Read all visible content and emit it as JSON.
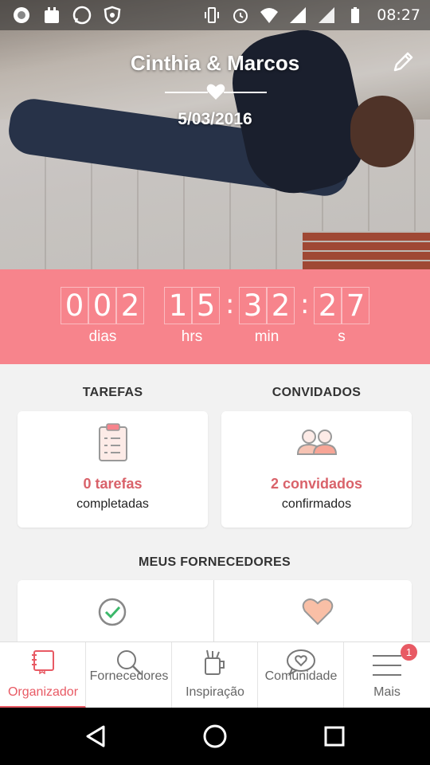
{
  "status_bar": {
    "time": "08:27"
  },
  "hero": {
    "couple_names": "Cinthia & Marcos",
    "date": "5/03/2016"
  },
  "countdown": {
    "days_digits": [
      "0",
      "0",
      "2"
    ],
    "hours_digits": [
      "1",
      "5"
    ],
    "minutes_digits": [
      "3",
      "2"
    ],
    "seconds_digits": [
      "2",
      "7"
    ],
    "separator": ":",
    "labels": {
      "days": "dias",
      "hours": "hrs",
      "minutes": "min",
      "seconds": "s"
    }
  },
  "tarefas": {
    "title": "TAREFAS",
    "count_text": "0 tarefas",
    "subtitle": "completadas"
  },
  "convidados": {
    "title": "CONVIDADOS",
    "count_text": "2 convidados",
    "subtitle": "confirmados"
  },
  "fornecedores": {
    "title": "MEUS FORNECEDORES"
  },
  "tabs": [
    {
      "label": "Organizador",
      "active": true
    },
    {
      "label": "Fornecedores",
      "active": false
    },
    {
      "label": "Inspiração",
      "active": false
    },
    {
      "label": "Comunidade",
      "active": false
    },
    {
      "label": "Mais",
      "active": false,
      "badge": "1"
    }
  ],
  "colors": {
    "accent": "#f7848c",
    "accent_text": "#d9626a",
    "tab_active": "#e85a64"
  },
  "icons": [
    "clipboard-icon",
    "guests-icon",
    "check-circle-icon",
    "heart-icon",
    "notebook-icon",
    "search-icon",
    "mug-icon",
    "heart-chat-icon",
    "menu-icon"
  ]
}
